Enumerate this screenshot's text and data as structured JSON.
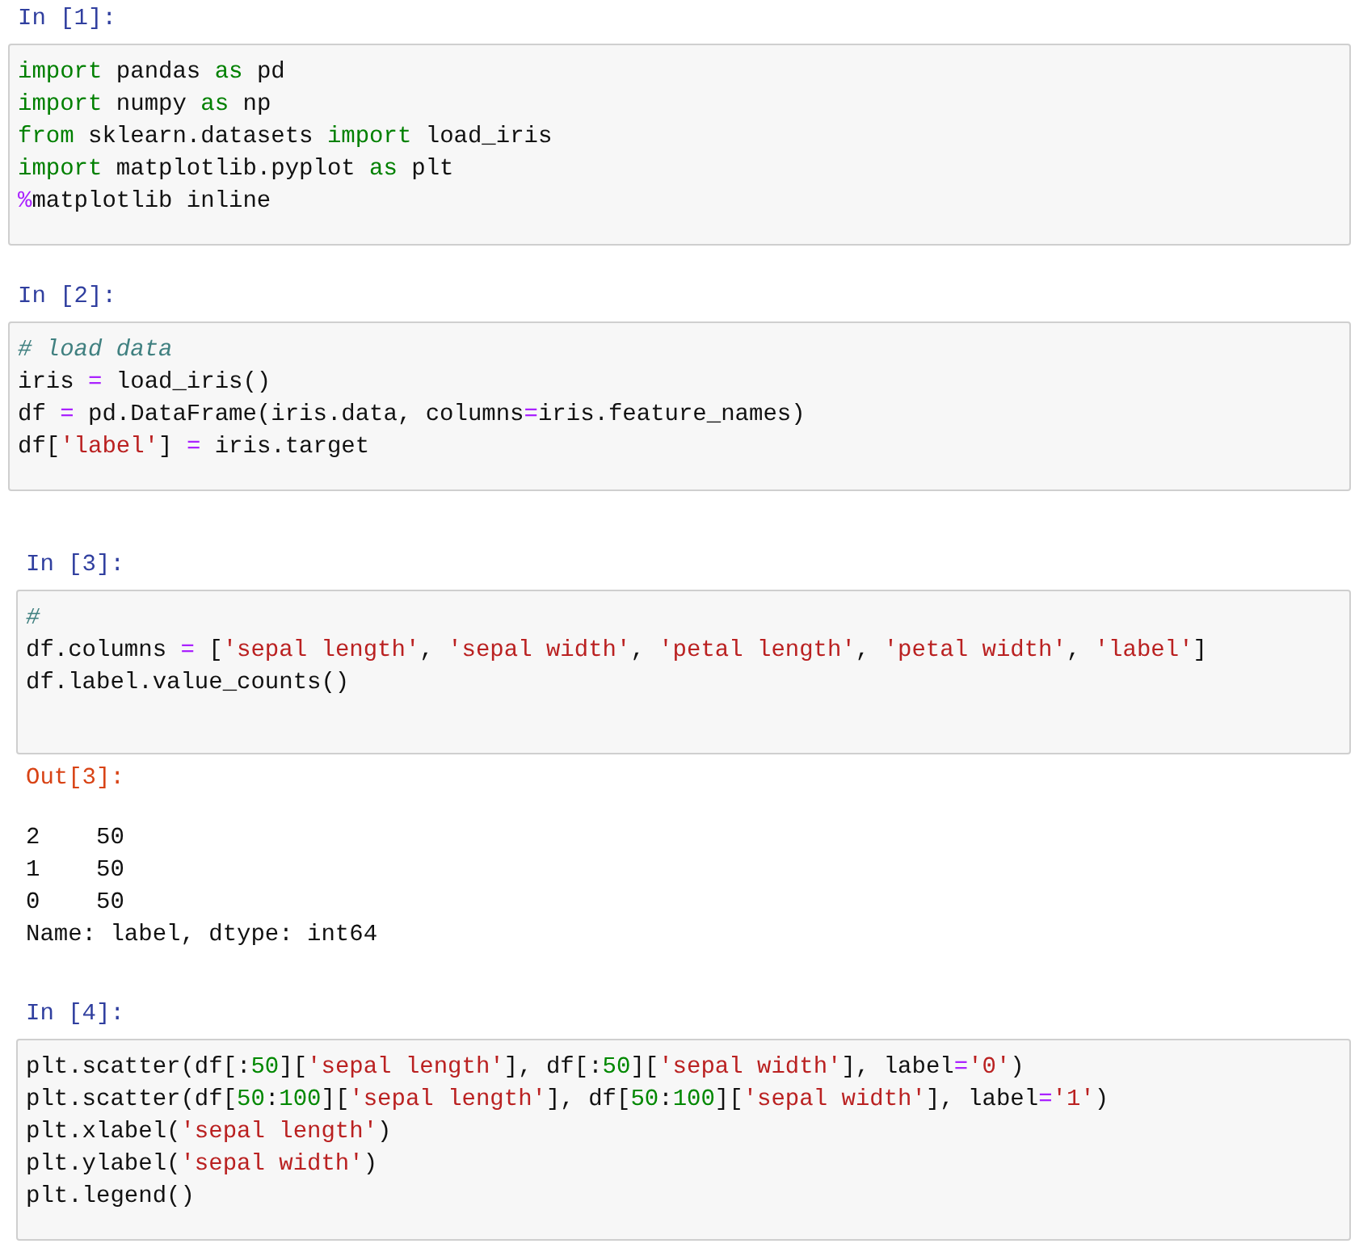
{
  "cells": [
    {
      "prompt": "In [1]:",
      "code": [
        [
          {
            "text": "import",
            "kind": "kw"
          },
          {
            "text": " pandas ",
            "kind": "plain"
          },
          {
            "text": "as",
            "kind": "kw"
          },
          {
            "text": " pd",
            "kind": "plain"
          }
        ],
        [
          {
            "text": "import",
            "kind": "kw"
          },
          {
            "text": " numpy ",
            "kind": "plain"
          },
          {
            "text": "as",
            "kind": "kw"
          },
          {
            "text": " np",
            "kind": "plain"
          }
        ],
        [
          {
            "text": "from",
            "kind": "kw"
          },
          {
            "text": " sklearn.datasets ",
            "kind": "plain"
          },
          {
            "text": "import",
            "kind": "kw"
          },
          {
            "text": " load_iris",
            "kind": "plain"
          }
        ],
        [
          {
            "text": "import",
            "kind": "kw"
          },
          {
            "text": " matplotlib.pyplot ",
            "kind": "plain"
          },
          {
            "text": "as",
            "kind": "kw"
          },
          {
            "text": " plt",
            "kind": "plain"
          }
        ],
        [
          {
            "text": "%",
            "kind": "op"
          },
          {
            "text": "matplotlib inline",
            "kind": "plain"
          }
        ]
      ]
    },
    {
      "prompt": "In [2]:",
      "code": [
        [
          {
            "text": "# load data",
            "kind": "comment"
          }
        ],
        [
          {
            "text": "iris ",
            "kind": "plain"
          },
          {
            "text": "=",
            "kind": "op"
          },
          {
            "text": " load_iris()",
            "kind": "plain"
          }
        ],
        [
          {
            "text": "df ",
            "kind": "plain"
          },
          {
            "text": "=",
            "kind": "op"
          },
          {
            "text": " pd.DataFrame(iris.data, columns",
            "kind": "plain"
          },
          {
            "text": "=",
            "kind": "op"
          },
          {
            "text": "iris.feature_names)",
            "kind": "plain"
          }
        ],
        [
          {
            "text": "df[",
            "kind": "plain"
          },
          {
            "text": "'label'",
            "kind": "str"
          },
          {
            "text": "] ",
            "kind": "plain"
          },
          {
            "text": "=",
            "kind": "op"
          },
          {
            "text": " iris.target",
            "kind": "plain"
          }
        ]
      ]
    },
    {
      "prompt": "In [3]:",
      "code": [
        [
          {
            "text": "#",
            "kind": "comment"
          }
        ],
        [
          {
            "text": "df.columns ",
            "kind": "plain"
          },
          {
            "text": "=",
            "kind": "op"
          },
          {
            "text": " [",
            "kind": "plain"
          },
          {
            "text": "'sepal length'",
            "kind": "str"
          },
          {
            "text": ", ",
            "kind": "plain"
          },
          {
            "text": "'sepal width'",
            "kind": "str"
          },
          {
            "text": ", ",
            "kind": "plain"
          },
          {
            "text": "'petal length'",
            "kind": "str"
          },
          {
            "text": ", ",
            "kind": "plain"
          },
          {
            "text": "'petal width'",
            "kind": "str"
          },
          {
            "text": ", ",
            "kind": "plain"
          },
          {
            "text": "'label'",
            "kind": "str"
          },
          {
            "text": "]",
            "kind": "plain"
          }
        ],
        [
          {
            "text": "df.label.value_counts()",
            "kind": "plain"
          }
        ]
      ],
      "output": {
        "prompt": "Out[3]:",
        "lines": [
          "2    50",
          "1    50",
          "0    50",
          "Name: label, dtype: int64"
        ]
      }
    },
    {
      "prompt": "In [4]:",
      "code": [
        [
          {
            "text": "plt.scatter(df[:",
            "kind": "plain"
          },
          {
            "text": "50",
            "kind": "num"
          },
          {
            "text": "][",
            "kind": "plain"
          },
          {
            "text": "'sepal length'",
            "kind": "str"
          },
          {
            "text": "], df[:",
            "kind": "plain"
          },
          {
            "text": "50",
            "kind": "num"
          },
          {
            "text": "][",
            "kind": "plain"
          },
          {
            "text": "'sepal width'",
            "kind": "str"
          },
          {
            "text": "], label",
            "kind": "plain"
          },
          {
            "text": "=",
            "kind": "op"
          },
          {
            "text": "'0'",
            "kind": "str"
          },
          {
            "text": ")",
            "kind": "plain"
          }
        ],
        [
          {
            "text": "plt.scatter(df[",
            "kind": "plain"
          },
          {
            "text": "50",
            "kind": "num"
          },
          {
            "text": ":",
            "kind": "plain"
          },
          {
            "text": "100",
            "kind": "num"
          },
          {
            "text": "][",
            "kind": "plain"
          },
          {
            "text": "'sepal length'",
            "kind": "str"
          },
          {
            "text": "], df[",
            "kind": "plain"
          },
          {
            "text": "50",
            "kind": "num"
          },
          {
            "text": ":",
            "kind": "plain"
          },
          {
            "text": "100",
            "kind": "num"
          },
          {
            "text": "][",
            "kind": "plain"
          },
          {
            "text": "'sepal width'",
            "kind": "str"
          },
          {
            "text": "], label",
            "kind": "plain"
          },
          {
            "text": "=",
            "kind": "op"
          },
          {
            "text": "'1'",
            "kind": "str"
          },
          {
            "text": ")",
            "kind": "plain"
          }
        ],
        [
          {
            "text": "plt.xlabel(",
            "kind": "plain"
          },
          {
            "text": "'sepal length'",
            "kind": "str"
          },
          {
            "text": ")",
            "kind": "plain"
          }
        ],
        [
          {
            "text": "plt.ylabel(",
            "kind": "plain"
          },
          {
            "text": "'sepal width'",
            "kind": "str"
          },
          {
            "text": ")",
            "kind": "plain"
          }
        ],
        [
          {
            "text": "plt.legend()",
            "kind": "plain"
          }
        ]
      ]
    }
  ]
}
